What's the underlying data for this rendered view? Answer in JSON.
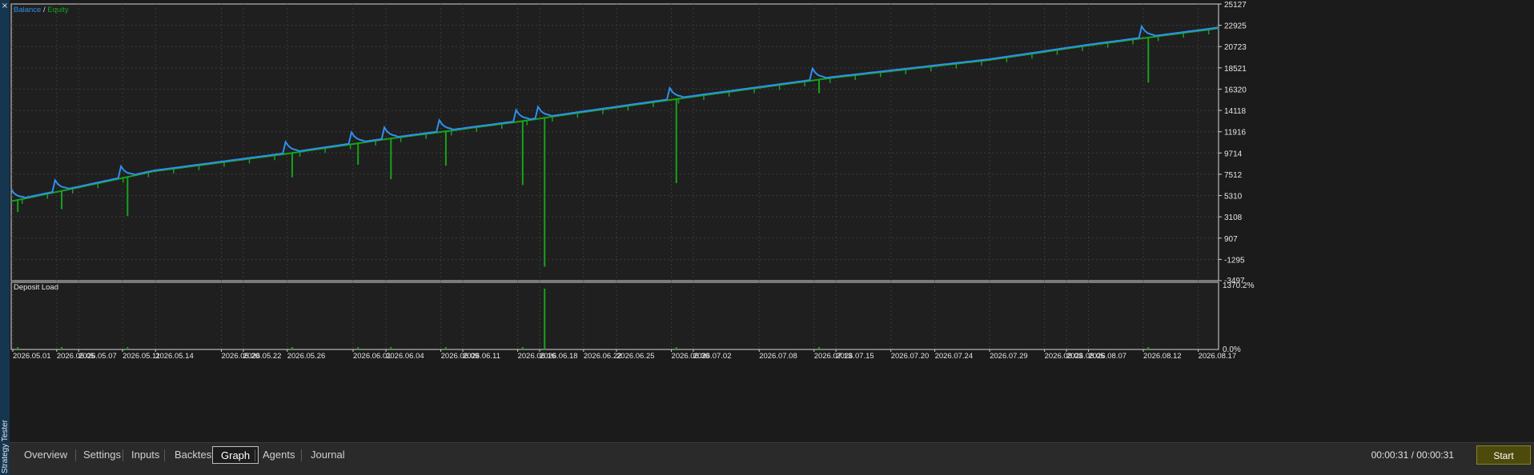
{
  "side_panel": {
    "label": "Strategy Tester",
    "close_glyph": "×"
  },
  "main_chart": {
    "legend": {
      "balance": "Balance",
      "separator": "/",
      "equity": "Equity"
    },
    "y_ticks": [
      "25127",
      "22925",
      "20723",
      "18521",
      "16320",
      "14118",
      "11916",
      "9714",
      "7512",
      "5310",
      "3108",
      "907",
      "-1295",
      "-3497"
    ],
    "y_range": [
      -3497,
      25127
    ],
    "colors": {
      "balance": "#2e8ff0",
      "equity": "#17a21b",
      "background": "#1f1f1f",
      "grid": "#3b3b3b",
      "axis_text": "#e6e6e6"
    }
  },
  "deposit_chart": {
    "title": "Deposit Load",
    "y_max_label": "1370.2%",
    "y_min_label": "0.0%"
  },
  "x_dates": [
    "2026.05.01",
    "2026.05.05",
    "2026.05.07",
    "2026.05.11",
    "2026.05.14",
    "2026.05.20",
    "2026.05.22",
    "2026.05.26",
    "2026.06.01",
    "2026.06.04",
    "2026.06.09",
    "2026.06.11",
    "2026.06.16",
    "2026.06.18",
    "2026.06.22",
    "2026.06.25",
    "2026.06.30",
    "2026.07.02",
    "2026.07.08",
    "2026.07.13",
    "2026.07.15",
    "2026.07.20",
    "2026.07.24",
    "2026.07.29",
    "2026.08.03",
    "2026.08.05",
    "2026.08.07",
    "2026.08.12",
    "2026.08.17"
  ],
  "chart_data": {
    "type": "line",
    "x_range": [
      "2026.05.01",
      "2026.08.19"
    ],
    "y_range": [
      -3497,
      25127
    ],
    "series": [
      {
        "name": "Balance",
        "x": [
          "2026.05.01",
          "2026.05.07",
          "2026.05.14",
          "2026.05.26",
          "2026.06.04",
          "2026.06.16",
          "2026.06.22",
          "2026.07.02",
          "2026.07.15",
          "2026.07.29",
          "2026.08.07",
          "2026.08.19"
        ],
        "values": [
          4800,
          6200,
          7900,
          9700,
          11200,
          13000,
          14000,
          15600,
          17600,
          19400,
          20900,
          22700
        ]
      },
      {
        "name": "Equity",
        "drawdown_spikes_x": [
          "2026.05.01",
          "2026.05.05",
          "2026.05.11",
          "2026.05.26",
          "2026.06.01",
          "2026.06.04",
          "2026.06.09",
          "2026.06.16",
          "2026.06.18",
          "2026.06.30",
          "2026.07.13",
          "2026.08.12"
        ],
        "drawdown_spikes_min": [
          3600,
          3900,
          3200,
          7200,
          8500,
          7000,
          8400,
          6400,
          -2050,
          6600,
          15900,
          17000
        ]
      }
    ],
    "deposit_load_series": {
      "name": "Deposit Load",
      "y_range": [
        0,
        1370.2
      ],
      "peak_x": "2026.06.18",
      "peak_value": 1370.2
    }
  },
  "tabs": [
    {
      "label": "Overview",
      "active": false
    },
    {
      "label": "Settings",
      "active": false
    },
    {
      "label": "Inputs",
      "active": false
    },
    {
      "label": "Backtest",
      "active": false
    },
    {
      "label": "Graph",
      "active": true
    },
    {
      "label": "Agents",
      "active": false
    },
    {
      "label": "Journal",
      "active": false
    }
  ],
  "status": {
    "timer": "00:00:31 / 00:00:31"
  },
  "start_button": {
    "label": "Start",
    "color": "#4d4a0c"
  }
}
